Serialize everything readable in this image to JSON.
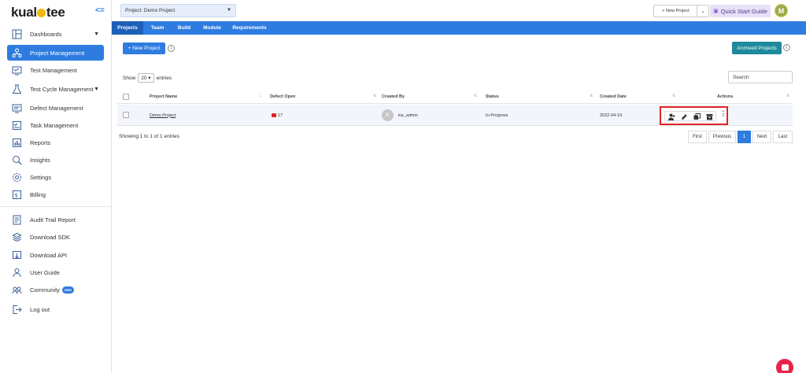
{
  "brand": {
    "name_before": "kual",
    "name_after": "tee"
  },
  "sidebar": {
    "items": [
      {
        "label": "Dashboards",
        "icon": "dashboard-icon",
        "caret": true
      },
      {
        "label": "Project Management",
        "icon": "project-management-icon",
        "active": true
      },
      {
        "label": "Test Management",
        "icon": "test-management-icon"
      },
      {
        "label": "Test Cycle Management",
        "icon": "test-cycle-icon",
        "caret": true
      },
      {
        "label": "Defect Management",
        "icon": "defect-icon"
      },
      {
        "label": "Task Management",
        "icon": "task-icon"
      },
      {
        "label": "Reports",
        "icon": "reports-icon"
      },
      {
        "label": "Insights",
        "icon": "insights-icon"
      },
      {
        "label": "Settings",
        "icon": "settings-icon"
      },
      {
        "label": "Billing",
        "icon": "billing-icon"
      },
      {
        "label": "Audit Trail Report",
        "icon": "audit-icon"
      },
      {
        "label": "Download SDK",
        "icon": "sdk-icon"
      },
      {
        "label": "Download API",
        "icon": "api-icon"
      },
      {
        "label": "User Guide",
        "icon": "user-guide-icon"
      },
      {
        "label": "Community",
        "icon": "community-icon",
        "badge": "new"
      },
      {
        "label": "Log out",
        "icon": "logout-icon"
      }
    ]
  },
  "header": {
    "project_label": "Project:",
    "project_value": "Demo Project",
    "new_project_label": "+ New Project",
    "quick_start_label": "Quick Start Guide",
    "avatar_initial": "M"
  },
  "tabs": [
    {
      "label": "Projects",
      "active": true
    },
    {
      "label": "Team"
    },
    {
      "label": "Build"
    },
    {
      "label": "Module"
    },
    {
      "label": "Requirements"
    }
  ],
  "toolbar": {
    "new_project_button": "+ New Project",
    "archived_button": "Archived Projects",
    "show_label": "Show",
    "entries_value": "20",
    "entries_label": "entries",
    "search_placeholder": "Search"
  },
  "table": {
    "columns": [
      "Project Name",
      "Defect Open",
      "Created By",
      "Status",
      "Created Date",
      "Actions"
    ],
    "rows": [
      {
        "project_name": "Demo Project",
        "defect_open": "17",
        "created_by_initial": "K",
        "created_by": "kw_admin",
        "status": "In-Progress",
        "created_date": "2022-04-19"
      }
    ]
  },
  "footer": {
    "showing": "Showing 1 to 1 of 1 entries",
    "pager": [
      "First",
      "Previous",
      "1",
      "Next",
      "Last"
    ],
    "current_page": "1"
  },
  "colors": {
    "primary": "#2f7ce0",
    "teal": "#1e8a9b",
    "highlight": "#e02424",
    "logo_accent": "#f2b90f"
  }
}
